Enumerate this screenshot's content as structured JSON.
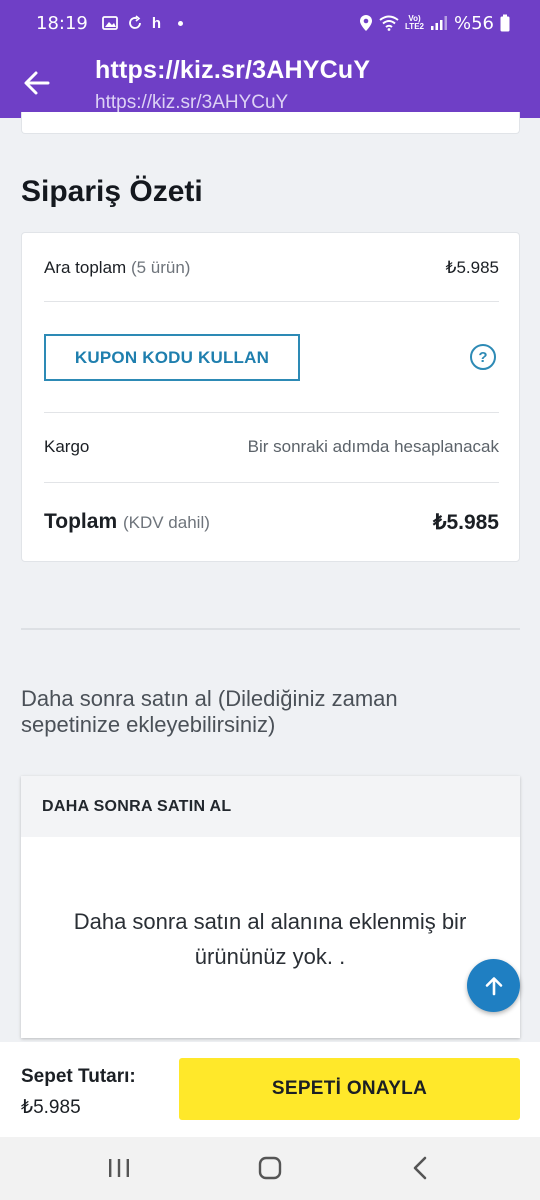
{
  "status_bar": {
    "time": "18:19",
    "notif_letter": "h",
    "lte_top": "Vo)",
    "lte_bottom": "LTE2",
    "battery": "%56"
  },
  "app_bar": {
    "title": "https://kiz.sr/3AHYCuY",
    "subtitle": "https://kiz.sr/3AHYCuY"
  },
  "summary": {
    "heading": "Sipariş Özeti",
    "subtotal_label": "Ara toplam",
    "subtotal_count": "(5 ürün)",
    "subtotal_value": "₺5.985",
    "coupon_label": "KUPON KODU KULLAN",
    "help_glyph": "?",
    "shipping_label": "Kargo",
    "shipping_value": "Bir sonraki adımda hesaplanacak",
    "total_label": "Toplam",
    "total_note": "(KDV dahil)",
    "total_value": "₺5.985"
  },
  "buy_later": {
    "heading": "Daha sonra satın al (Dilediğiniz zaman sepetinize ekleyebilirsiniz)",
    "card_title": "DAHA SONRA SATIN AL",
    "empty_text": "Daha sonra satın al alanına eklenmiş bir ürününüz yok. ."
  },
  "bottom": {
    "cart_label": "Sepet Tutarı:",
    "cart_value": "₺5.985",
    "confirm_label": "SEPETİ ONAYLA"
  },
  "colors": {
    "brand_purple": "#6f3fc6",
    "accent_blue": "#2d8ab5",
    "confirm_yellow": "#ffe82a"
  },
  "icons": {
    "back": "arrow-left-icon",
    "help": "question-circle-icon",
    "fab": "arrow-up-icon"
  }
}
